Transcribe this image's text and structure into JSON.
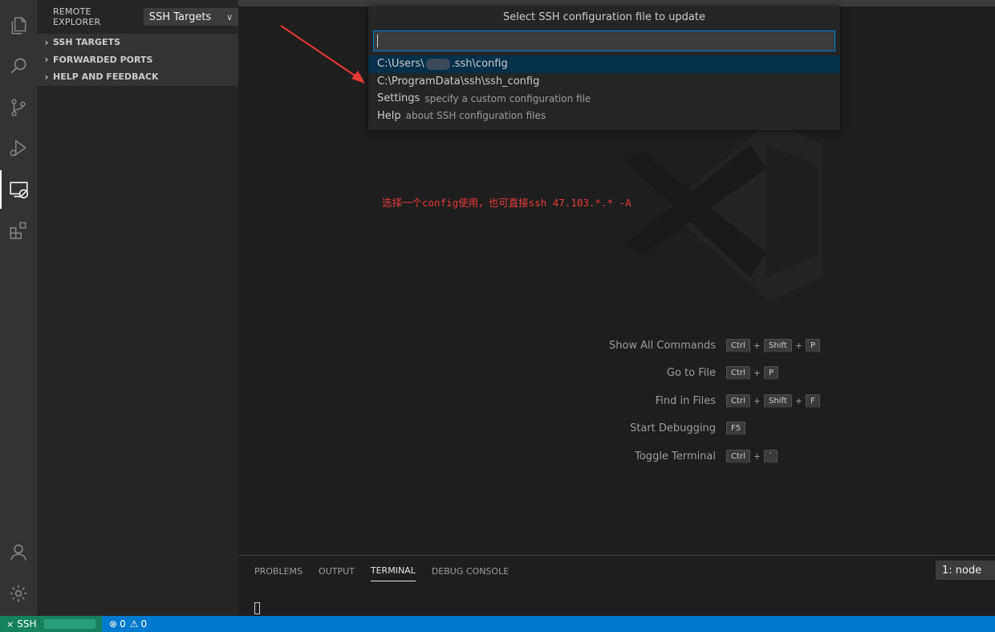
{
  "sidebar": {
    "title": "REMOTE EXPLORER",
    "select_value": "SSH Targets",
    "sections": [
      {
        "label": "SSH TARGETS"
      },
      {
        "label": "FORWARDED PORTS"
      },
      {
        "label": "HELP AND FEEDBACK"
      }
    ]
  },
  "quickpick": {
    "title": "Select SSH configuration file to update",
    "input_value": "",
    "items": [
      {
        "label_prefix": "C:\\Users\\",
        "label_suffix": ".ssh\\config",
        "description": ""
      },
      {
        "label": "C:\\ProgramData\\ssh\\ssh_config",
        "description": ""
      },
      {
        "label": "Settings",
        "description": "specify a custom configuration file"
      },
      {
        "label": "Help",
        "description": "about SSH configuration files"
      }
    ]
  },
  "annotation": "选择一个config使用，也可直接ssh 47.103.*.* -A",
  "shortcuts": [
    {
      "label": "Show All Commands",
      "keys": [
        "Ctrl",
        "Shift",
        "P"
      ]
    },
    {
      "label": "Go to File",
      "keys": [
        "Ctrl",
        "P"
      ]
    },
    {
      "label": "Find in Files",
      "keys": [
        "Ctrl",
        "Shift",
        "F"
      ]
    },
    {
      "label": "Start Debugging",
      "keys": [
        "F5"
      ]
    },
    {
      "label": "Toggle Terminal",
      "keys": [
        "Ctrl",
        "`"
      ]
    }
  ],
  "panel": {
    "tabs": [
      "PROBLEMS",
      "OUTPUT",
      "TERMINAL",
      "DEBUG CONSOLE"
    ],
    "active_tab": "TERMINAL",
    "terminal_select": "1: node"
  },
  "statusbar": {
    "remote_label": "SSH",
    "errors": "0",
    "warnings": "0"
  },
  "colors": {
    "status_bar": "#007acc",
    "remote_indicator": "#16825d",
    "annotation": "#e83a3a",
    "selection": "#062f4a"
  },
  "icons": [
    "files-icon",
    "search-icon",
    "source-control-icon",
    "run-debug-icon",
    "remote-explorer-icon",
    "extensions-icon",
    "account-icon",
    "gear-icon"
  ]
}
